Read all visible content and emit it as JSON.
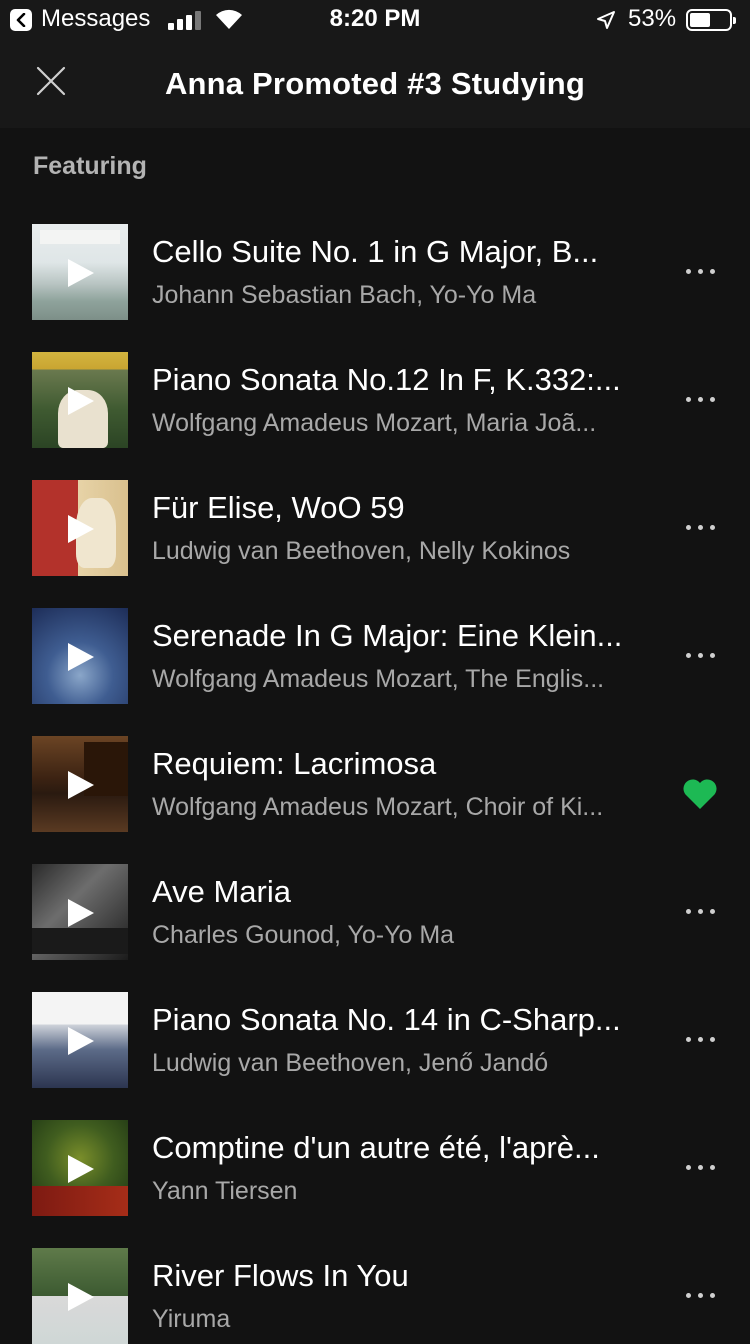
{
  "status_bar": {
    "back_app": "Messages",
    "time": "8:20 PM",
    "battery": "53%",
    "battery_level": 0.53
  },
  "header": {
    "title": "Anna Promoted #3 Studying"
  },
  "section": {
    "label": "Featuring"
  },
  "colors": {
    "background": "#121212",
    "header": "#181818",
    "liked": "#1db954",
    "subtitle": "#a8a8a8"
  },
  "tracks": [
    {
      "title": "Cello Suite No. 1 in G Major, B...",
      "artists": "Johann Sebastian Bach, Yo-Yo Ma",
      "liked": false
    },
    {
      "title": "Piano Sonata No.12 In F, K.332:...",
      "artists": "Wolfgang Amadeus Mozart, Maria Joã...",
      "liked": false
    },
    {
      "title": "Für Elise, WoO 59",
      "artists": "Ludwig van Beethoven, Nelly Kokinos",
      "liked": false
    },
    {
      "title": "Serenade In G Major: Eine Klein...",
      "artists": "Wolfgang Amadeus Mozart, The Englis...",
      "liked": false
    },
    {
      "title": "Requiem: Lacrimosa",
      "artists": "Wolfgang Amadeus Mozart, Choir of Ki...",
      "liked": true
    },
    {
      "title": "Ave Maria",
      "artists": "Charles Gounod, Yo-Yo Ma",
      "liked": false
    },
    {
      "title": "Piano Sonata No. 14 in C-Sharp...",
      "artists": "Ludwig van Beethoven, Jenő Jandó",
      "liked": false
    },
    {
      "title": "Comptine d'un autre été, l'aprè...",
      "artists": "Yann Tiersen",
      "liked": false
    },
    {
      "title": "River Flows In You",
      "artists": "Yiruma",
      "liked": false
    }
  ]
}
